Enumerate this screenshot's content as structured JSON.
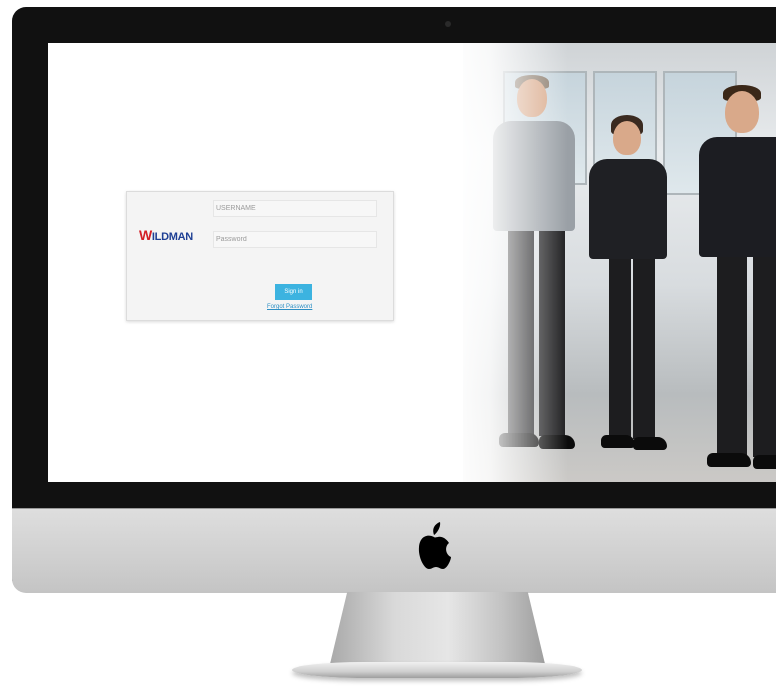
{
  "login": {
    "username_placeholder": "USERNAME",
    "password_placeholder": "Password",
    "signin_label": "Sign in",
    "forgot_label": "Forgot Password"
  },
  "brand": {
    "logo_initial": "W",
    "logo_rest": "ILDMAN",
    "logo_color": "#1e3f94",
    "logo_accent": "#d31f26"
  },
  "colors": {
    "signin_button": "#3cb3e0",
    "link": "#2d8fc4"
  },
  "icons": [
    "apple-icon"
  ]
}
